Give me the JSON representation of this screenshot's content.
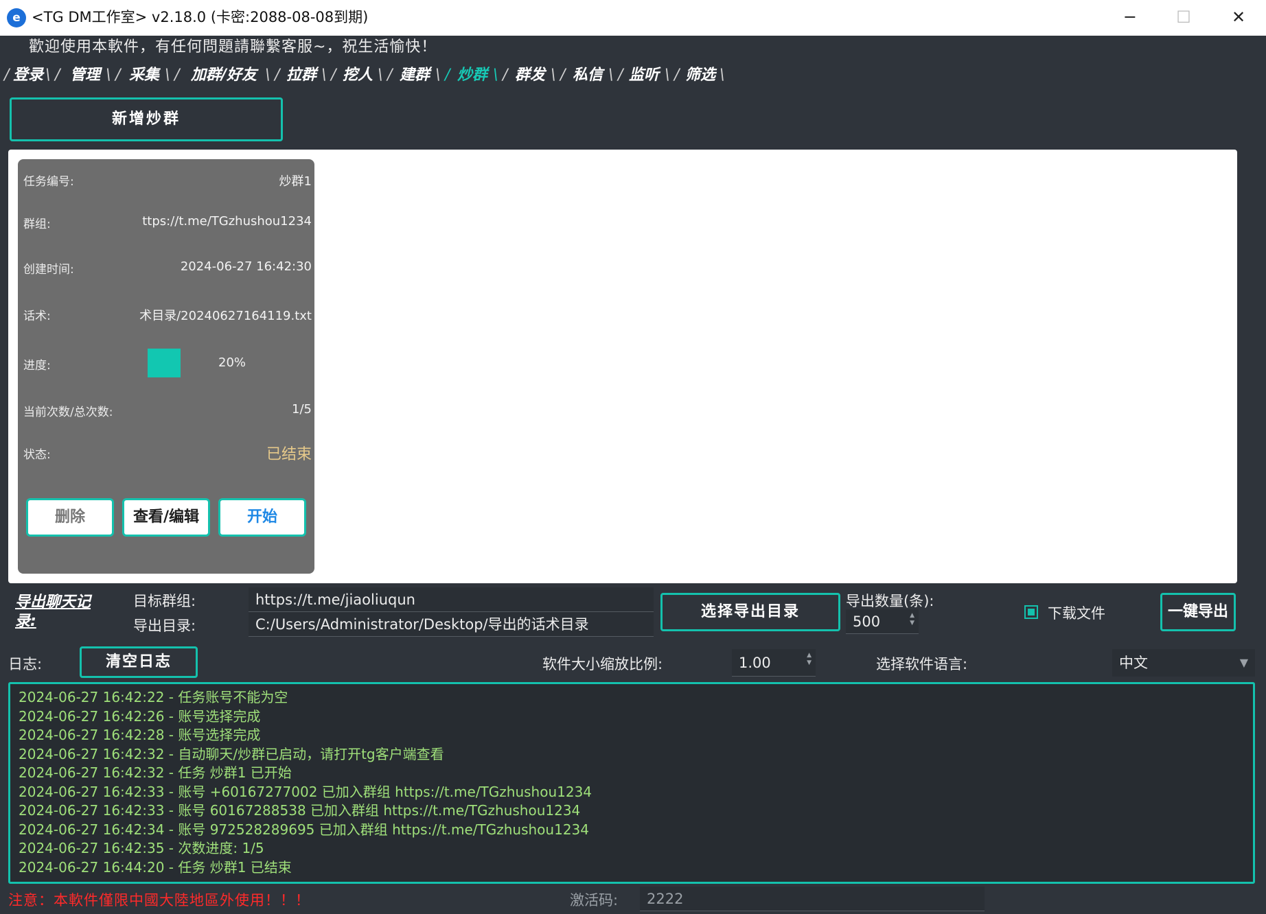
{
  "window": {
    "title": "<TG DM工作室> v2.18.0 (卡密:2088-08-08到期)",
    "app_icon": "e-icon",
    "controls": {
      "minimize": "─",
      "maximize": "☐",
      "close": "✕"
    }
  },
  "welcome_text": "歡迎使用本軟件，有任何問題請聯繫客服~，祝生活愉快！",
  "tabs": [
    {
      "label": "登录"
    },
    {
      "label": "管理"
    },
    {
      "label": "采集"
    },
    {
      "label": "加群/好友"
    },
    {
      "label": "拉群"
    },
    {
      "label": "挖人"
    },
    {
      "label": "建群"
    },
    {
      "label": "炒群",
      "active": true
    },
    {
      "label": "群发"
    },
    {
      "label": "私信"
    },
    {
      "label": "监听"
    },
    {
      "label": "筛选"
    }
  ],
  "add_button": "新增炒群",
  "task_card": {
    "rows": [
      {
        "label": "任务编号:",
        "value": "炒群1"
      },
      {
        "label": "群组:",
        "value": "ttps://t.me/TGzhushou1234"
      },
      {
        "label": "创建时间:",
        "value": "2024-06-27 16:42:30"
      },
      {
        "label": "话术:",
        "value": "术目录/20240627164119.txt"
      },
      {
        "label": "进度:",
        "value": "20%"
      },
      {
        "label": "当前次数/总次数:",
        "value": "1/5"
      },
      {
        "label": "状态:",
        "value": "已结束"
      }
    ],
    "progress_fraction": 0.2,
    "status_color": "#e6c98a",
    "buttons": {
      "delete": "删除",
      "view_edit": "查看/编辑",
      "start": "开始"
    }
  },
  "export": {
    "title": "导出聊天记录:",
    "target_group_label": "目标群组:",
    "target_group_value": "https://t.me/jiaoliuqun",
    "dir_label": "导出目录:",
    "dir_value": "C:/Users/Administrator/Desktop/导出的话术目录",
    "choose_dir_button": "选择导出目录",
    "count_label": "导出数量(条):",
    "count_value": "500",
    "download_label": "下载文件",
    "download_checked": true,
    "export_button": "一键导出"
  },
  "log": {
    "label": "日志:",
    "clear_button": "清空日志",
    "lines": [
      "2024-06-27 16:42:22 - 任务账号不能为空",
      "2024-06-27 16:42:26 - 账号选择完成",
      "2024-06-27 16:42:28 - 账号选择完成",
      "2024-06-27 16:42:32 - 自动聊天/炒群已启动，请打开tg客户端查看",
      "2024-06-27 16:42:32 - 任务 炒群1 已开始",
      "2024-06-27 16:42:33 - 账号 +60167277002 已加入群组 https://t.me/TGzhushou1234",
      "2024-06-27 16:42:33 - 账号 60167288538 已加入群组 https://t.me/TGzhushou1234",
      "2024-06-27 16:42:34 - 账号 972528289695 已加入群组 https://t.me/TGzhushou1234",
      "2024-06-27 16:42:35 - 次数进度: 1/5",
      "2024-06-27 16:44:20 - 任务 炒群1 已结束"
    ],
    "text_color": "#9fe07a"
  },
  "settings": {
    "scale_label": "软件大小缩放比例:",
    "scale_value": "1.00",
    "lang_label": "选择软件语言:",
    "lang_value": "中文"
  },
  "footer": {
    "notice": "注意：本軟件僅限中國大陸地區外使用！！！",
    "activation_label": "激活码:",
    "activation_value": "2222"
  },
  "colors": {
    "accent": "#14c1ad",
    "background": "#2f343b",
    "notice": "#ff2a2a"
  }
}
